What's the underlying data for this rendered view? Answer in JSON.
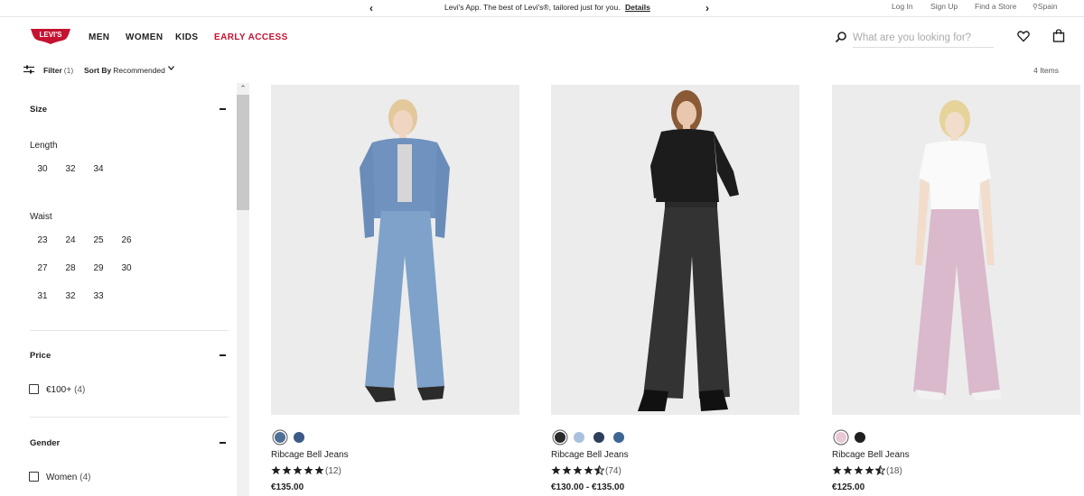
{
  "topbar": {
    "promo_text": "Levi's App. The best of Levi's®, tailored just for you.",
    "promo_link": "Details",
    "login": "Log In",
    "signup": "Sign Up",
    "find_store": "Find a Store",
    "region": "Spain"
  },
  "header": {
    "logo_text": "LEVI'S",
    "nav": [
      "MEN",
      "WOMEN",
      "KIDS",
      "EARLY ACCESS"
    ],
    "search_placeholder": "What are you looking for?"
  },
  "toolbar": {
    "filter_label": "Filter",
    "filter_count": "(1)",
    "sort_label": "Sort By",
    "sort_value": "Recommended",
    "items_count": "4 Items"
  },
  "sidebar": {
    "size": {
      "title": "Size",
      "length_label": "Length",
      "lengths": [
        "30",
        "32",
        "34"
      ],
      "waist_label": "Waist",
      "waists": [
        "23",
        "24",
        "25",
        "26",
        "27",
        "28",
        "29",
        "30",
        "31",
        "32",
        "33"
      ]
    },
    "price": {
      "title": "Price",
      "option_label": "€100+",
      "option_count": "(4)"
    },
    "gender": {
      "title": "Gender",
      "option_label": "Women",
      "option_count": "(4)"
    }
  },
  "products": [
    {
      "name": "Ribcage Bell Jeans",
      "rating": 5,
      "reviews": "(12)",
      "price": "€135.00",
      "swatches": [
        "#4f6f99",
        "#3b5a86"
      ]
    },
    {
      "name": "Ribcage Bell Jeans",
      "rating": 4.5,
      "reviews": "(74)",
      "price": "€130.00 - €135.00",
      "swatches": [
        "#2a2a2a",
        "#a9c1dc",
        "#2e3f5c",
        "#3f6594"
      ]
    },
    {
      "name": "Ribcage Bell Jeans",
      "rating": 4.5,
      "reviews": "(18)",
      "price": "€125.00",
      "swatches": [
        "#e9c7d6",
        "#1f1f1f"
      ]
    }
  ],
  "colors": {
    "brand_red": "#c41230",
    "text": "#1f1f1f"
  }
}
